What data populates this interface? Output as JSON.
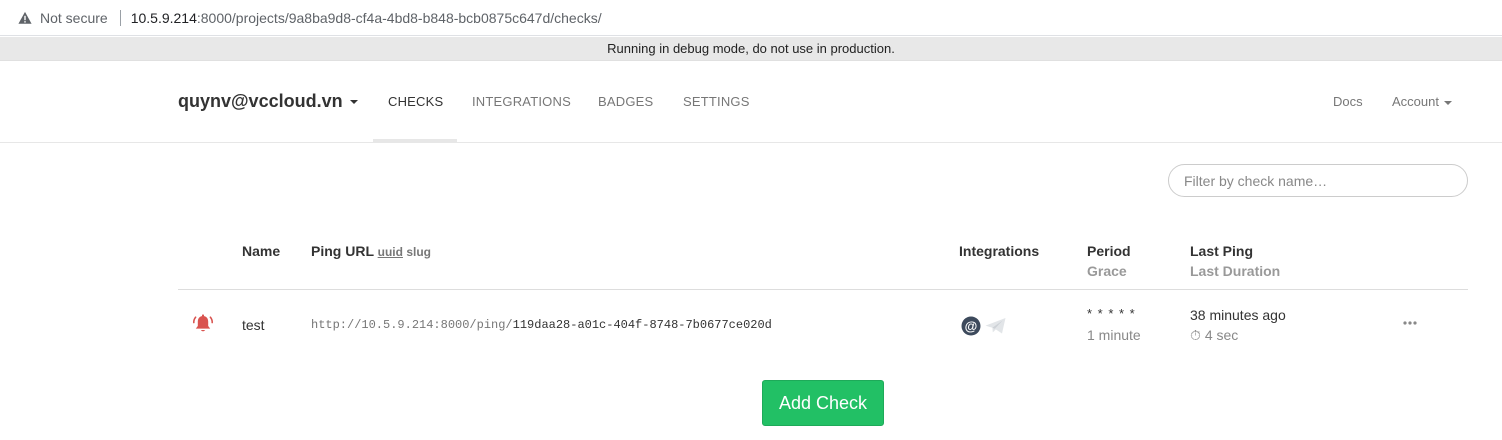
{
  "browser": {
    "security_label": "Not secure",
    "url_host": "10.5.9.214",
    "url_rest": ":8000/projects/9a8ba9d8-cf4a-4bd8-b848-bcb0875c647d/checks/"
  },
  "debug_banner": "Running in debug mode, do not use in production.",
  "nav": {
    "project": "quynv@vccloud.vn",
    "items": [
      "CHECKS",
      "INTEGRATIONS",
      "BADGES",
      "SETTINGS"
    ],
    "active": "CHECKS",
    "docs": "Docs",
    "account": "Account"
  },
  "filter": {
    "placeholder": "Filter by check name…"
  },
  "table": {
    "headers": {
      "name": "Name",
      "ping_url": "Ping URL",
      "uuid": "uuid",
      "slug": "slug",
      "integrations": "Integrations",
      "period": "Period",
      "grace": "Grace",
      "last_ping": "Last Ping",
      "last_duration": "Last Duration"
    },
    "rows": [
      {
        "status": "down",
        "name": "test",
        "ping_base": "http://10.5.9.214:8000/ping/",
        "ping_code": "119daa28-a01c-404f-8748-7b0677ce020d",
        "period": "* * * * *",
        "grace": "1 minute",
        "last_ping": "38 minutes ago",
        "last_duration": "4 sec"
      }
    ]
  },
  "add_button": "Add Check",
  "colors": {
    "down": "#d9534f",
    "primary": "#22c065"
  }
}
